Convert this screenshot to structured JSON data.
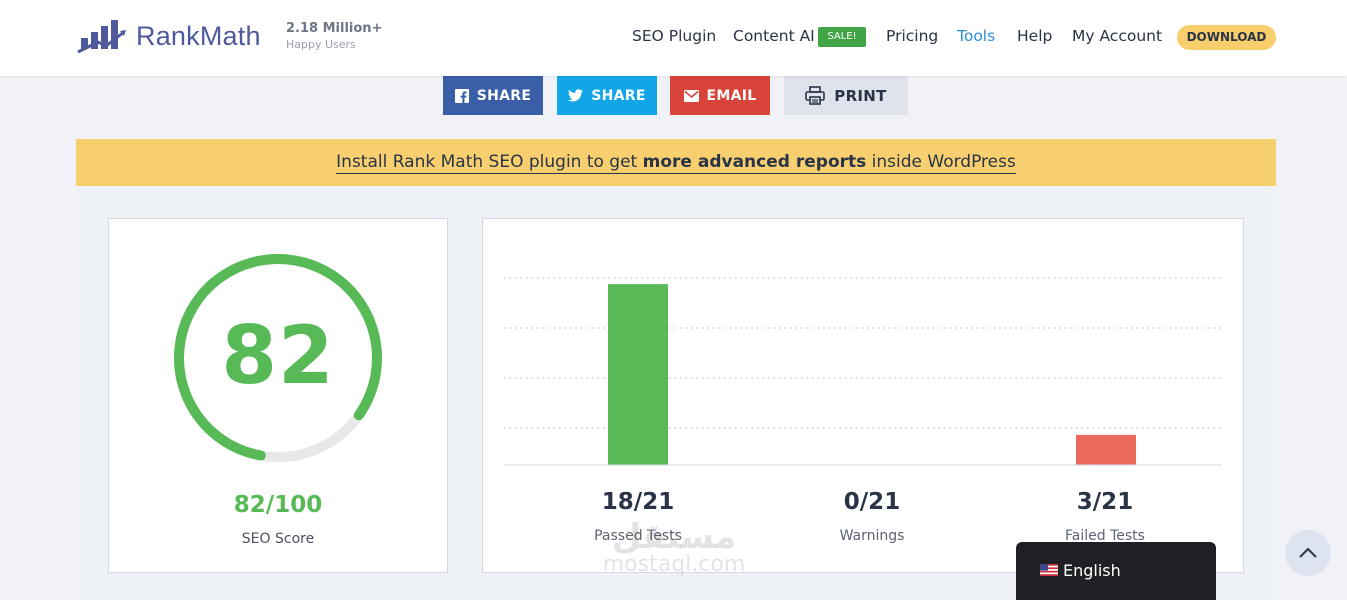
{
  "brand": {
    "name": "RankMath",
    "users_count": "2.18 Million+",
    "users_label": "Happy Users"
  },
  "nav": {
    "items": [
      "SEO Plugin",
      "Content AI",
      "Pricing",
      "Tools",
      "Help",
      "My Account"
    ],
    "sale_badge": "SALE!",
    "download": "DOWNLOAD",
    "active": "Tools"
  },
  "share": {
    "facebook": "SHARE",
    "twitter": "SHARE",
    "email": "EMAIL",
    "print": "PRINT"
  },
  "banner": {
    "before": "Install Rank Math SEO plugin to get ",
    "bold": "more advanced reports",
    "after": " inside WordPress"
  },
  "score": {
    "value": "82",
    "fraction": "82/100",
    "label": "SEO Score",
    "percent": 82
  },
  "chart_data": {
    "type": "bar",
    "categories": [
      "Passed Tests",
      "Warnings",
      "Failed Tests"
    ],
    "values": [
      18,
      0,
      3
    ],
    "total": 21,
    "value_labels": [
      "18/21",
      "0/21",
      "3/21"
    ],
    "colors": [
      "#57ba57",
      "#f5b335",
      "#ec6a5c"
    ],
    "grid": "dotted",
    "ylim": [
      0,
      21
    ]
  },
  "watermark": {
    "arabic": "مستقل",
    "latin": "mostaql.com"
  },
  "language": {
    "label": "English"
  },
  "colors": {
    "accent_green": "#57ba57",
    "brand": "#4e5a9b",
    "link_active": "#2a8ed6"
  }
}
